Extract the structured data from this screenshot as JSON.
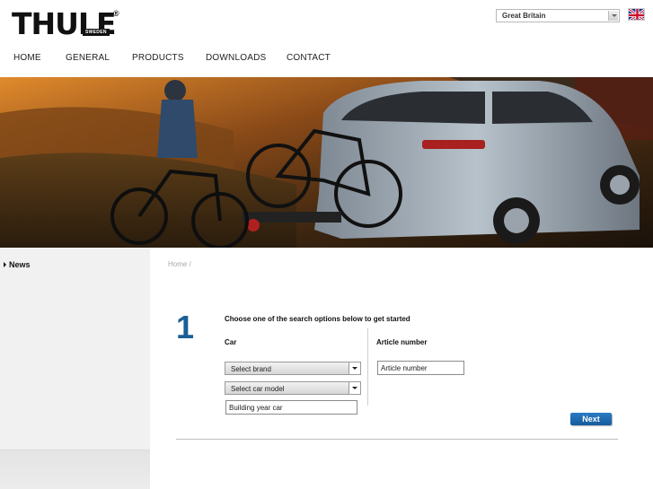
{
  "brand": {
    "name": "THULE",
    "tagline": "SWEDEN",
    "mark": "®"
  },
  "country_selector": {
    "value": "Great Britain"
  },
  "nav": {
    "items": [
      {
        "label": "HOME"
      },
      {
        "label": "GENERAL"
      },
      {
        "label": "PRODUCTS"
      },
      {
        "label": "DOWNLOADS"
      },
      {
        "label": "CONTACT"
      }
    ]
  },
  "sidebar": {
    "news_label": "News"
  },
  "breadcrumb": {
    "text": "Home /"
  },
  "search": {
    "step_number": "1",
    "instruction": "Choose one of the search options below to get started",
    "car": {
      "label": "Car",
      "brand_select": "Select brand",
      "model_select": "Select car model",
      "year_value": "Building year car"
    },
    "article": {
      "label": "Article number",
      "value": "Article number"
    },
    "next_label": "Next"
  },
  "colors": {
    "accent": "#1a5e96",
    "button": "#1f6fb5"
  }
}
